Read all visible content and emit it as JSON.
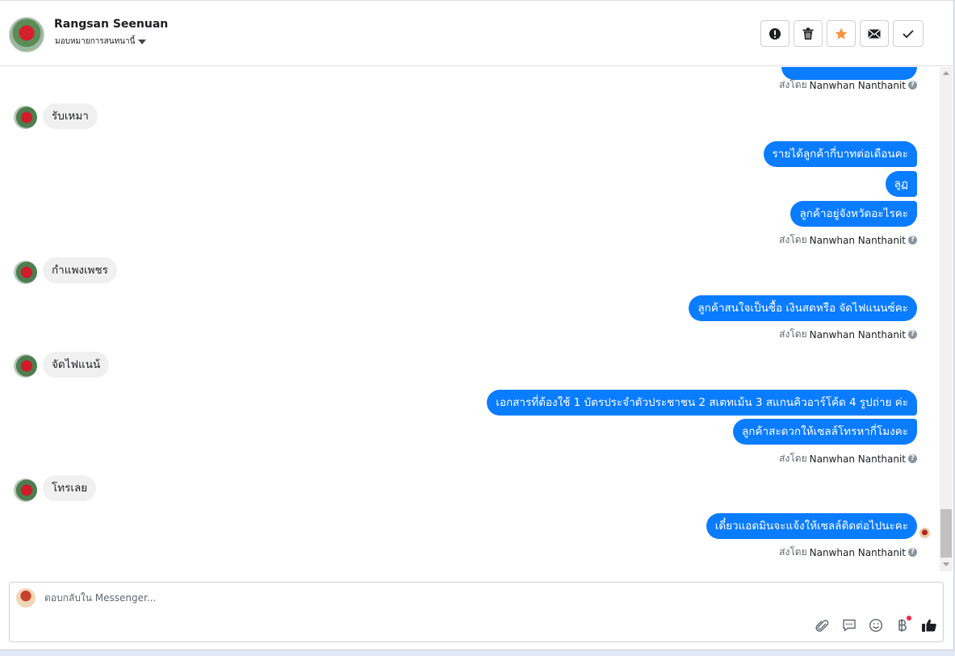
{
  "header": {
    "contact_name": "Rangsan Seenuan",
    "assign_label": "มอบหมายการสนทนานี้"
  },
  "actions": [
    {
      "name": "report-button",
      "icon": "exclamation-icon"
    },
    {
      "name": "delete-button",
      "icon": "trash-icon"
    },
    {
      "name": "star-button",
      "icon": "star-icon",
      "color": "#f7923b"
    },
    {
      "name": "mark-unread-button",
      "icon": "envelope-icon"
    },
    {
      "name": "mark-done-button",
      "icon": "check-icon"
    }
  ],
  "sent_by_prefix": "ส่งโดย",
  "sender_name": "Nanwhan Nanthanit",
  "messages": {
    "in_1": "รับเหมา",
    "out_1": "รายได้ลูกค้ากี่บาทต่อเดือนคะ",
    "out_2": "ลูฏ",
    "out_3": "ลูกค้าอยู่จังหวัดอะไรคะ",
    "in_2": "กำแพงเพชร",
    "out_4": "ลูกค้าสนใจเป็นซื้อ เงินสดหรือ จัดไฟแนนซ์คะ",
    "in_3": "จัดไฟแนน้",
    "out_5": "เอกสารที่ต้องใช้ 1 บัตรประจำตัวประชาชน 2 สเตทเม้น 3 สแกนคิวอาร์โค้ด 4 รูปถ่าย ค่ะ",
    "out_6": "ลูกค้าสะดวกให้เซลล์โทรหากี่โมงคะ",
    "in_4": "โทรเลย",
    "out_7": "เดี๋ยวแอดมินจะแจ้งให้เซลล์ติดต่อไปนะคะ"
  },
  "composer": {
    "placeholder": "ตอบกลับใน Messenger..."
  },
  "colors": {
    "outgoing_bubble": "#0a7cff",
    "incoming_bubble": "#f0f0f0",
    "star": "#f7923b"
  }
}
